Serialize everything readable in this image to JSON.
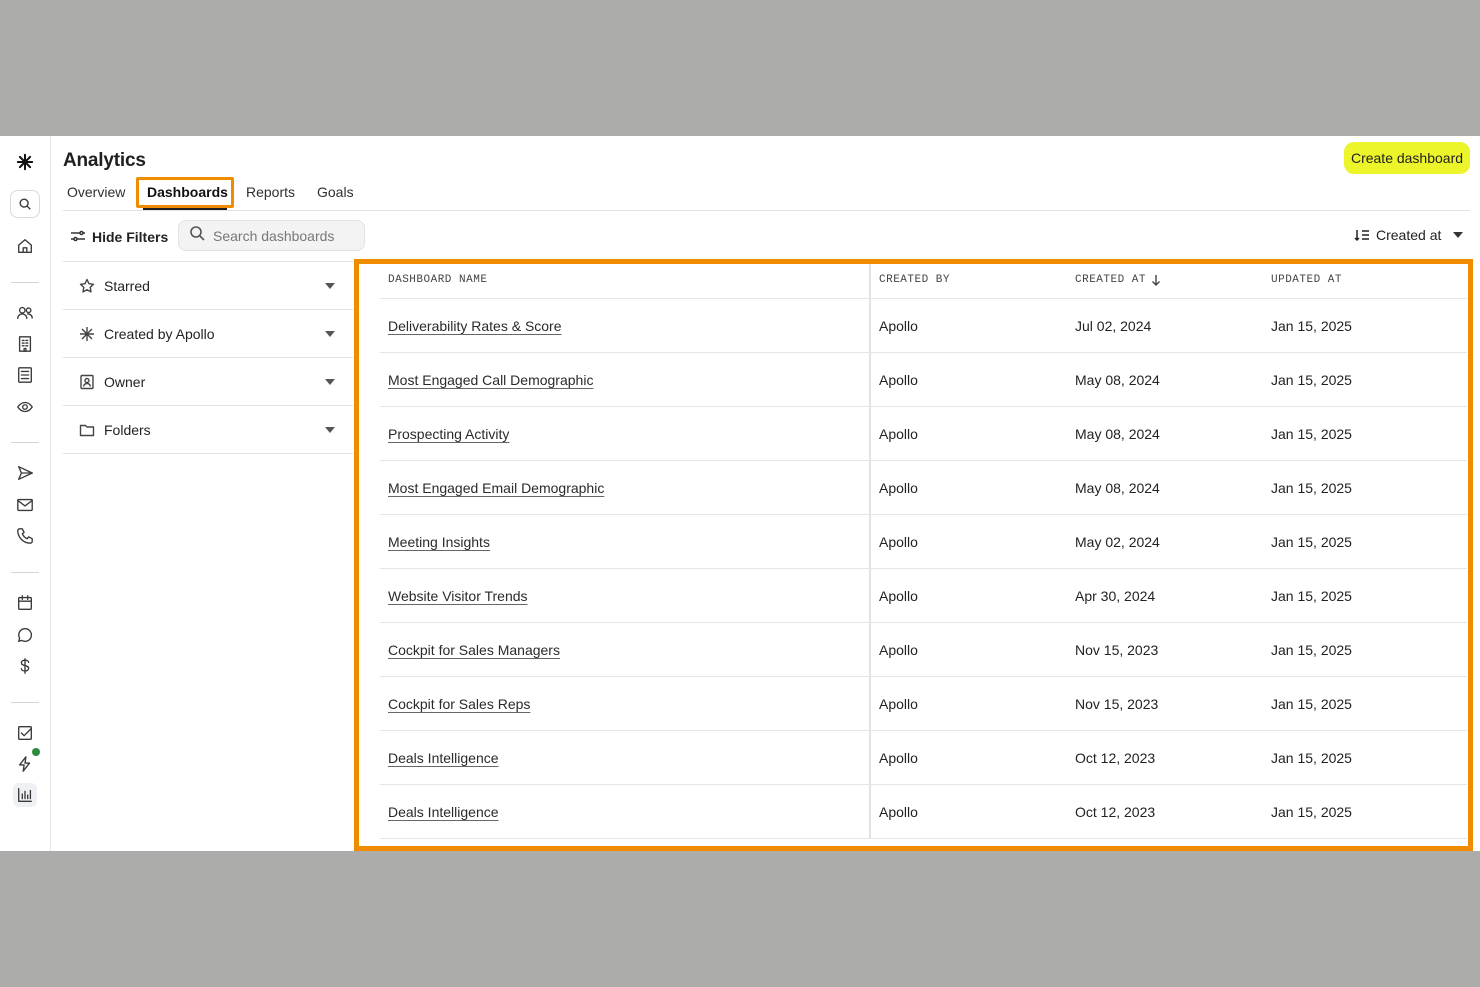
{
  "header": {
    "title": "Analytics",
    "create_button": "Create dashboard"
  },
  "tabs": [
    {
      "label": "Overview"
    },
    {
      "label": "Dashboards"
    },
    {
      "label": "Reports"
    },
    {
      "label": "Goals"
    }
  ],
  "active_tab": "Dashboards",
  "toolbar": {
    "hide_filters": "Hide Filters",
    "search_placeholder": "Search dashboards",
    "sort_label": "Created at"
  },
  "filters": [
    {
      "label": "Starred",
      "icon": "star-icon"
    },
    {
      "label": "Created by Apollo",
      "icon": "apollo-logo-icon"
    },
    {
      "label": "Owner",
      "icon": "owner-icon"
    },
    {
      "label": "Folders",
      "icon": "folder-icon"
    }
  ],
  "table": {
    "columns": [
      "DASHBOARD NAME",
      "CREATED BY",
      "CREATED AT",
      "UPDATED AT"
    ],
    "sorted_column": "CREATED AT",
    "sort_direction": "descending",
    "rows": [
      {
        "name": "Deliverability Rates & Score",
        "created_by": "Apollo",
        "created_at": "Jul 02, 2024",
        "updated_at": "Jan 15, 2025"
      },
      {
        "name": "Most Engaged Call Demographic",
        "created_by": "Apollo",
        "created_at": "May 08, 2024",
        "updated_at": "Jan 15, 2025"
      },
      {
        "name": "Prospecting Activity",
        "created_by": "Apollo",
        "created_at": "May 08, 2024",
        "updated_at": "Jan 15, 2025"
      },
      {
        "name": "Most Engaged Email Demographic",
        "created_by": "Apollo",
        "created_at": "May 08, 2024",
        "updated_at": "Jan 15, 2025"
      },
      {
        "name": "Meeting Insights",
        "created_by": "Apollo",
        "created_at": "May 02, 2024",
        "updated_at": "Jan 15, 2025"
      },
      {
        "name": "Website Visitor Trends",
        "created_by": "Apollo",
        "created_at": "Apr 30, 2024",
        "updated_at": "Jan 15, 2025"
      },
      {
        "name": "Cockpit for Sales Managers",
        "created_by": "Apollo",
        "created_at": "Nov 15, 2023",
        "updated_at": "Jan 15, 2025"
      },
      {
        "name": "Cockpit for Sales Reps",
        "created_by": "Apollo",
        "created_at": "Nov 15, 2023",
        "updated_at": "Jan 15, 2025"
      },
      {
        "name": "Deals Intelligence",
        "created_by": "Apollo",
        "created_at": "Oct 12, 2023",
        "updated_at": "Jan 15, 2025"
      },
      {
        "name": "Deals Intelligence",
        "created_by": "Apollo",
        "created_at": "Oct 12, 2023",
        "updated_at": "Jan 15, 2025"
      }
    ]
  },
  "rail": {
    "icons": [
      "apollo-logo-icon",
      "search-icon",
      "home-icon",
      "people-icon",
      "building-icon",
      "list-icon",
      "eye-refresh-icon",
      "send-icon",
      "mail-icon",
      "phone-icon",
      "calendar-icon",
      "chat-icon",
      "dollar-icon",
      "checkbox-icon",
      "lightning-icon",
      "bar-chart-icon"
    ],
    "active": "bar-chart-icon",
    "notification_color": "#2f8a3c"
  },
  "colors": {
    "accent_button": "#ecf52a",
    "highlight": "#f08c00"
  }
}
